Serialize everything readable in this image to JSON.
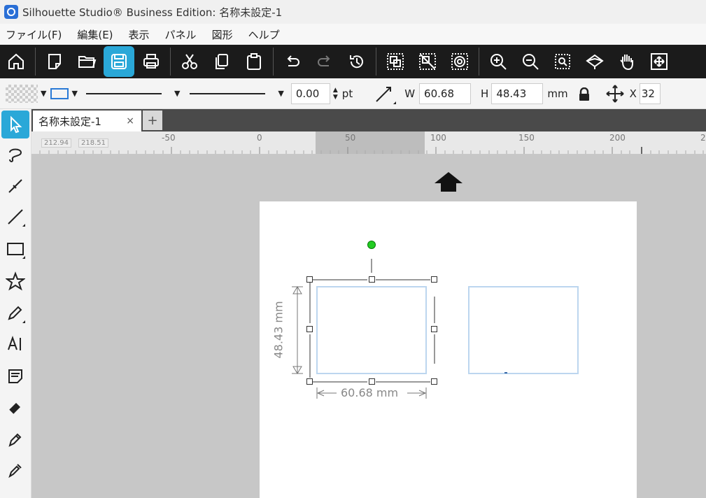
{
  "app": {
    "title": "Silhouette Studio® Business Edition: 名称未設定-1"
  },
  "menu": {
    "items": [
      "ファイル(F)",
      "編集(E)",
      "表示",
      "パネル",
      "図形",
      "ヘルプ"
    ]
  },
  "toolbar": {
    "buttons": [
      "home-icon",
      "new-document-icon",
      "open-folder-icon",
      "save-icon",
      "print-icon",
      "cut-icon",
      "copy-icon",
      "paste-icon",
      "undo-icon",
      "redo-icon",
      "history-icon",
      "group-icon",
      "ungroup-icon",
      "release-compound-icon",
      "zoom-in-icon",
      "zoom-out-icon",
      "zoom-selection-icon",
      "zoom-fit-icon",
      "pan-icon",
      "fit-page-icon"
    ],
    "active": "save-icon",
    "accent_color": "#2aa8d8"
  },
  "props": {
    "line_width_value": "0.00",
    "line_width_unit": "pt",
    "w_label": "W",
    "w_value": "60.68",
    "h_label": "H",
    "h_value": "48.43",
    "size_unit": "mm",
    "x_label": "X",
    "x_value": "32"
  },
  "tabs": {
    "doc_tab_label": "名称未設定-1",
    "close_label": "×",
    "add_label": "+"
  },
  "ruler": {
    "coord_x": "212.94",
    "coord_y": "218.51",
    "labels": [
      "-50",
      "0",
      "50",
      "100",
      "150",
      "200",
      "2"
    ]
  },
  "selection": {
    "height_label": "48.43 mm",
    "width_label": "60.68 mm",
    "handle_color": "#22cc22",
    "outline_color": "#bcd6ef"
  },
  "tools": [
    "select-icon",
    "point-edit-icon",
    "knife-icon",
    "line-tool-icon",
    "rectangle-tool-icon",
    "star-tool-icon",
    "pencil-tool-icon",
    "text-tool-icon",
    "note-icon",
    "eraser-icon",
    "pen-icon",
    "eyedropper-icon"
  ]
}
